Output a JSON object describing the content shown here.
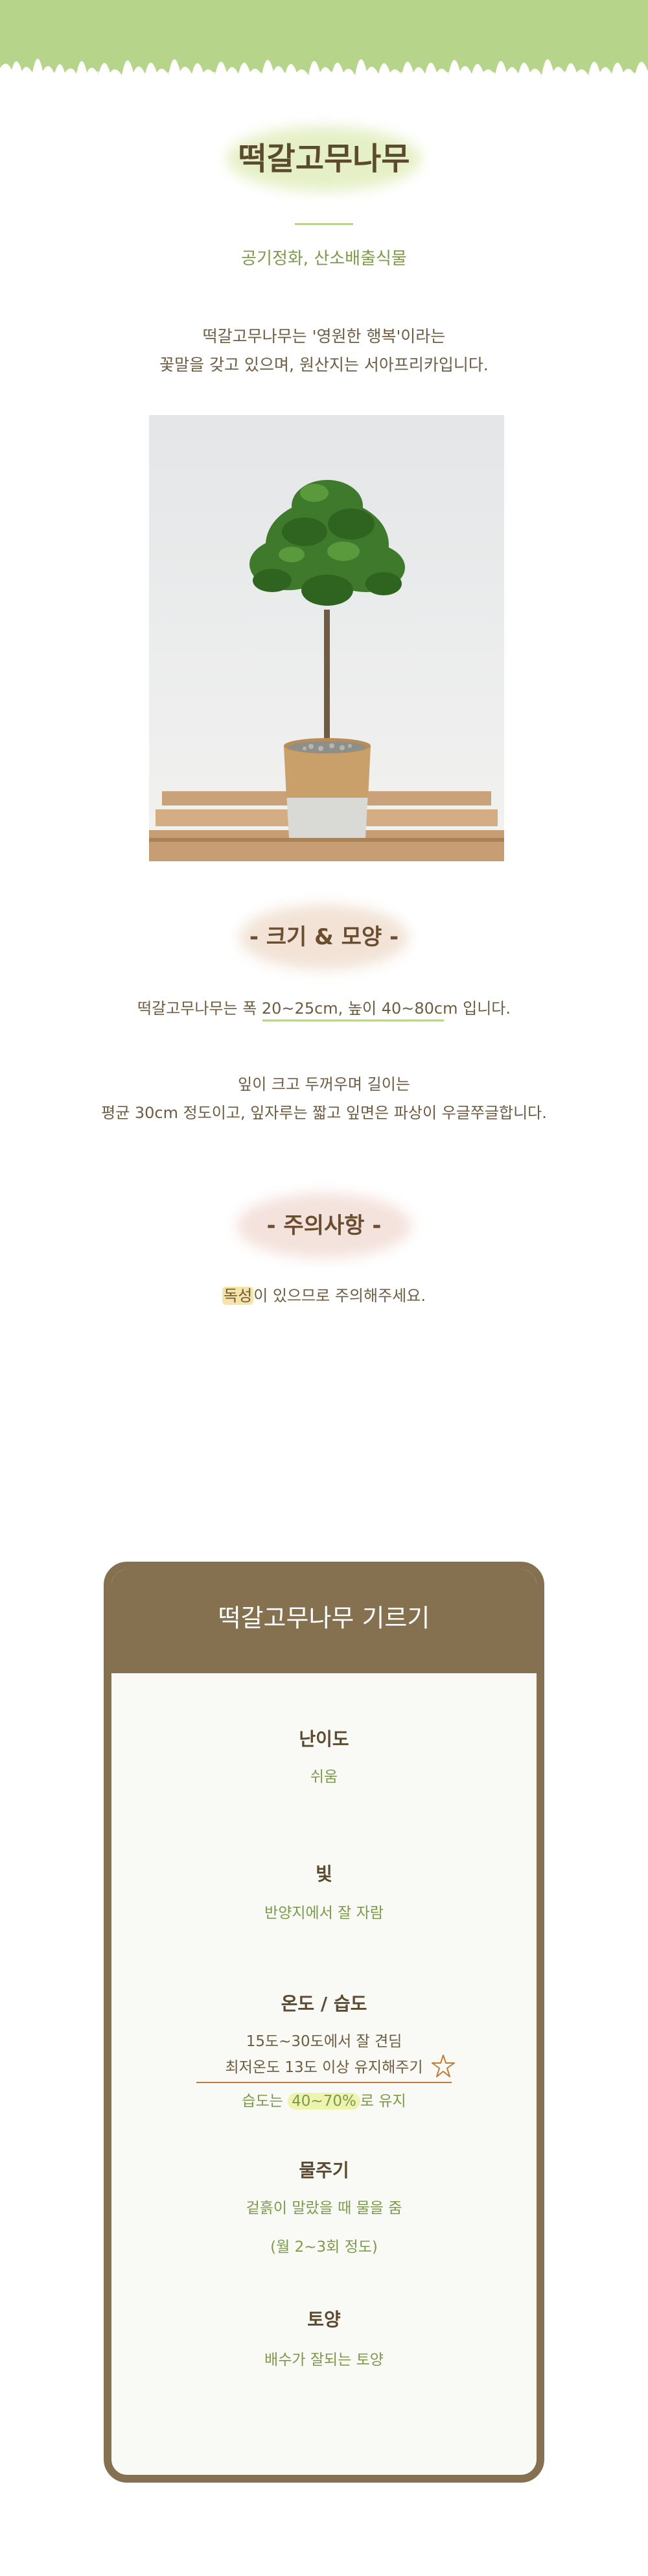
{
  "product": {
    "name": "떡갈고무나무",
    "tagline": "공기정화, 산소배출식물",
    "intro_line1": "떡갈고무나무는 '영원한 행복'이라는",
    "intro_line2": "꽃말을 갖고 있으며, 원산지는 서아프리카입니다."
  },
  "size_section": {
    "title": "- 크기 & 모양 -",
    "size_text": "떡갈고무나무는 폭 20~25cm, 높이 40~80cm 입니다.",
    "leaf_line1": "잎이 크고 두꺼우며 길이는",
    "leaf_line2": "평균 30cm 정도이고, 잎자루는 짧고 잎면은 파상이 우글쭈글합니다."
  },
  "caution_section": {
    "title": "- 주의사항 -",
    "highlight": "독성",
    "text_rest": "이 있으므로 주의해주세요."
  },
  "care": {
    "header": "떡갈고무나무 기르기",
    "difficulty": {
      "title": "난이도",
      "value": "쉬움"
    },
    "light": {
      "title": "빛",
      "value": "반양지에서 잘 자람"
    },
    "temperature": {
      "title": "온도 / 습도",
      "line1": "15도~30도에서 잘 견딤",
      "line2": "최저온도 13도 이상 유지해주기",
      "humidity_prefix": "습도는 ",
      "humidity_highlight": "40~70%",
      "humidity_suffix": "로 유지"
    },
    "watering": {
      "title": "물주기",
      "line1": "겉흙이 말랐을 때 물을 줌",
      "line2": "(월 2~3회 정도)"
    },
    "soil": {
      "title": "토양",
      "value": "배수가 잘되는 토양"
    }
  },
  "colors": {
    "banner": "#b6d48a",
    "accent_green": "#7d9a4a",
    "card_brown": "#857050",
    "text_brown": "#6e5c42"
  }
}
